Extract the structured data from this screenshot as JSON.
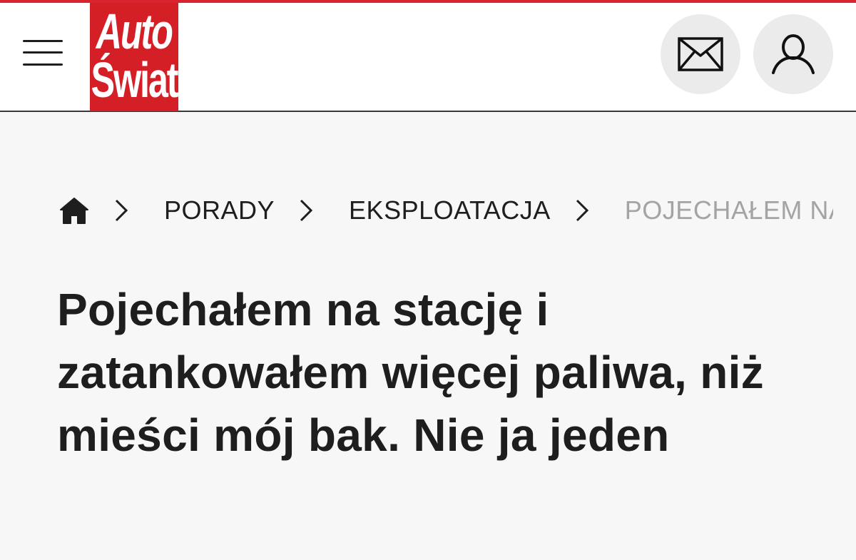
{
  "header": {
    "logo_line1": "Auto",
    "logo_line2": "Świat",
    "menu_icon": "hamburger-menu-icon",
    "mail_icon": "mail-icon",
    "user_icon": "user-icon"
  },
  "breadcrumb": {
    "home_icon": "home-icon",
    "separator_icon": "chevron-right-icon",
    "items": [
      {
        "label": "PORADY"
      },
      {
        "label": "EKSPLOATACJA"
      }
    ],
    "current": "POJECHAŁEM NA STACJĘ I ZATANKOWAŁEM WIĘCEJ PALIWA, NIŻ MIEŚCI MÓJ BAK. NIE JA JEDEN"
  },
  "article": {
    "title": "Pojechałem na stację i zatankowałem więcej paliwa, niż mieści mój bak. Nie ja jeden"
  },
  "colors": {
    "brand_red": "#d41f27",
    "top_line": "#d9232e",
    "text": "#1e1e1e",
    "muted": "#a4a4a4",
    "page_bg": "#f7f7f7",
    "icon_button_bg": "#ebebeb"
  }
}
